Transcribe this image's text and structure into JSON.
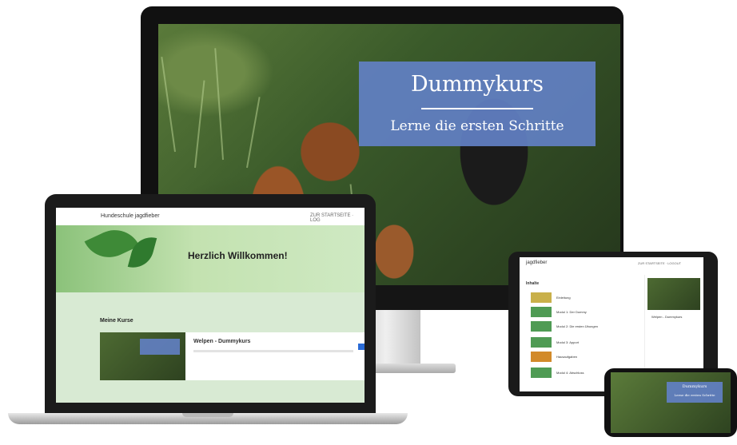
{
  "desktop": {
    "hero_title": "Dummykurs",
    "hero_subtitle": "Lerne die ersten Schritte",
    "accent_color": "#6280c4"
  },
  "laptop": {
    "brand": "Hundeschule jagdfieber",
    "nav_right": "ZUR STARTSEITE · LOG",
    "welcome_title": "Herzlich Willkommen!",
    "my_courses_heading": "Meine Kurse",
    "course_title": "Welpen - Dummykurs"
  },
  "tablet": {
    "brand": "jagdfieber",
    "nav_right": "ZUR STARTSEITE · LOGOUT",
    "panel_title": "Inhalte",
    "lessons": [
      "Einleitung",
      "Modul 1: Der Dummy",
      "Modul 2: Die ersten Übungen",
      "Modul 3: Apport",
      "Hausaufgaben",
      "Modul 4: Abschluss"
    ],
    "side_caption": "Welpen - Dummykurs"
  },
  "phone": {
    "hero_title": "Dummykurs",
    "hero_subtitle": "Lerne die ersten Schritte"
  }
}
